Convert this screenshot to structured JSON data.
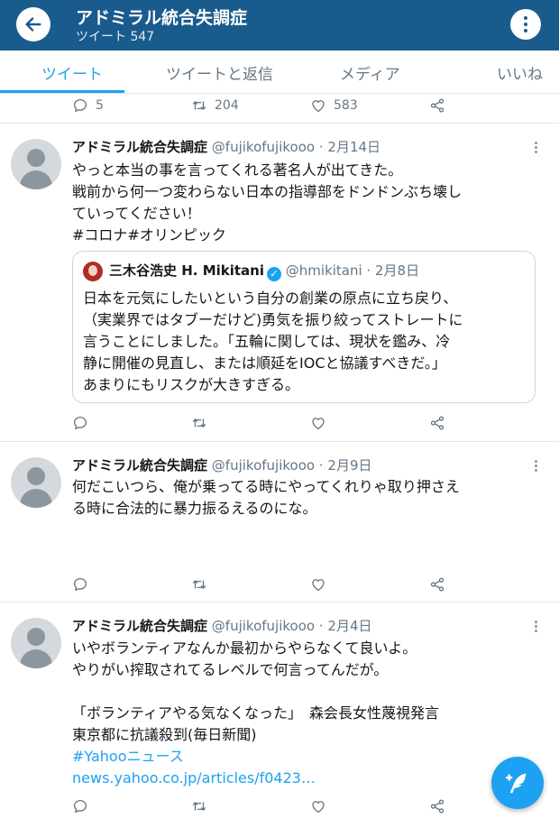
{
  "header": {
    "title": "アドミラル統合失調症",
    "subtitle": "ツイート 547"
  },
  "tabs": [
    {
      "label": "ツイート",
      "active": true
    },
    {
      "label": "ツイートと返信",
      "active": false
    },
    {
      "label": "メディア",
      "active": false
    },
    {
      "label": "いいね",
      "active": false
    }
  ],
  "top_actions": {
    "reply": "5",
    "retweet": "204",
    "like": "583"
  },
  "tweets": [
    {
      "name": "アドミラル統合失調症",
      "handle": "@fujikofujikooo",
      "dot": "·",
      "date": "2月14日",
      "lines": [
        "やっと本当の事を言ってくれる著名人が出てきた。",
        "戦前から何一つ変わらない日本の指導部をドンドンぶち壊し",
        "ていってください！",
        "#コロナ#オリンピック"
      ],
      "quote": {
        "name": "三木谷浩史 H. Mikitani",
        "verified_mark": "✓",
        "handle": "@hmikitani",
        "dot": "·",
        "date": "2月8日",
        "lines": [
          "日本を元気にしたいという自分の創業の原点に立ち戻り、",
          "（実業界ではタブーだけど)勇気を振り絞ってストレートに",
          "言うことにしました。「五輪に関しては、現状を鑑み、冷",
          "静に開催の見直し、または順延をIOCと協議すべきだ。」",
          "あまりにもリスクが大きすぎる。"
        ]
      }
    },
    {
      "name": "アドミラル統合失調症",
      "handle": "@fujikofujikooo",
      "dot": "·",
      "date": "2月9日",
      "lines": [
        "何だこいつら、俺が乗ってる時にやってくれりゃ取り押さえ",
        "る時に合法的に暴力振るえるのにな。"
      ]
    },
    {
      "name": "アドミラル統合失調症",
      "handle": "@fujikofujikooo",
      "dot": "·",
      "date": "2月4日",
      "lines": [
        "いやボランティアなんか最初からやらなくて良いよ。",
        "やりがい搾取されてるレベルで何言ってんだが。",
        "",
        "「ボランティアやる気なくなった」　森会長女性蔑視発言",
        "東京都に抗議殺到(毎日新聞)"
      ],
      "hashtag": "#Yahooニュース",
      "url": "news.yahoo.co.jp/articles/f0423…"
    }
  ],
  "colors": {
    "header_bg": "#1a5b8e",
    "accent": "#1da1f2",
    "muted": "#657786",
    "border": "#e1e8ed"
  },
  "icons": [
    "back-arrow-icon",
    "more-vertical-icon",
    "reply-icon",
    "retweet-icon",
    "like-icon",
    "share-icon",
    "compose-icon",
    "verified-icon"
  ]
}
